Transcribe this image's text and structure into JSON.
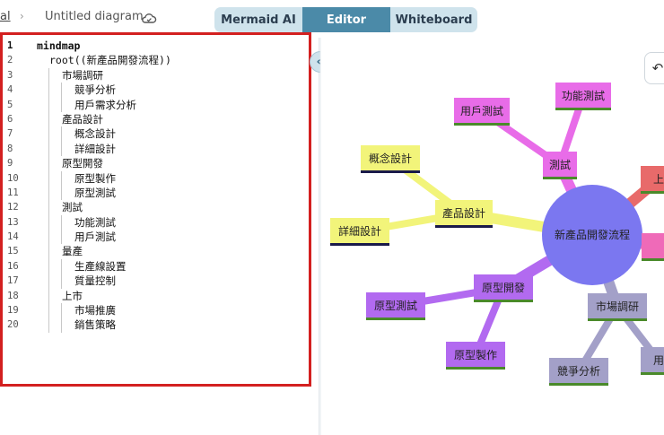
{
  "header": {
    "breadcrumb_prev": "al",
    "breadcrumb_sep": "›",
    "diagram_title": "Untitled diagram",
    "tabs": [
      "Mermaid AI",
      "Editor",
      "Whiteboard"
    ],
    "active_tab": "Editor"
  },
  "editor": {
    "lines": [
      {
        "n": "1",
        "text": "mindmap",
        "indent": 0
      },
      {
        "n": "2",
        "text": "root((新產品開發流程))",
        "indent": 1
      },
      {
        "n": "3",
        "text": "市場調研",
        "indent": 2
      },
      {
        "n": "4",
        "text": "競爭分析",
        "indent": 3
      },
      {
        "n": "5",
        "text": "用戶需求分析",
        "indent": 3
      },
      {
        "n": "6",
        "text": "產品設計",
        "indent": 2
      },
      {
        "n": "7",
        "text": "概念設計",
        "indent": 3
      },
      {
        "n": "8",
        "text": "詳細設計",
        "indent": 3
      },
      {
        "n": "9",
        "text": "原型開發",
        "indent": 2
      },
      {
        "n": "10",
        "text": "原型製作",
        "indent": 3
      },
      {
        "n": "11",
        "text": "原型測試",
        "indent": 3
      },
      {
        "n": "12",
        "text": "測試",
        "indent": 2
      },
      {
        "n": "13",
        "text": "功能測試",
        "indent": 3
      },
      {
        "n": "14",
        "text": "用戶測試",
        "indent": 3
      },
      {
        "n": "15",
        "text": "量產",
        "indent": 2
      },
      {
        "n": "16",
        "text": "生產線設置",
        "indent": 3
      },
      {
        "n": "17",
        "text": "質量控制",
        "indent": 3
      },
      {
        "n": "18",
        "text": "上市",
        "indent": 2
      },
      {
        "n": "19",
        "text": "市場推廣",
        "indent": 3
      },
      {
        "n": "20",
        "text": "銷售策略",
        "indent": 3
      }
    ]
  },
  "controls": {
    "collapse_icon": "«",
    "undo_icon": "↶"
  },
  "mindmap": {
    "root": "新產品開發流程",
    "root_color": "#7b77f0",
    "nodes": [
      {
        "id": "design",
        "label": "產品設計",
        "color": "#f2f47a",
        "underline": "#1a1a4a"
      },
      {
        "id": "concept",
        "label": "概念設計",
        "color": "#f2f47a",
        "underline": "#1a1a4a"
      },
      {
        "id": "detail",
        "label": "詳細設計",
        "color": "#f2f47a",
        "underline": "#1a1a4a"
      },
      {
        "id": "test",
        "label": "測試",
        "color": "#e86ce8",
        "underline": "#4a8a2a"
      },
      {
        "id": "functest",
        "label": "功能測試",
        "color": "#e86ce8",
        "underline": "#4a8a2a"
      },
      {
        "id": "usertest",
        "label": "用戶測試",
        "color": "#e86ce8",
        "underline": "#4a8a2a"
      },
      {
        "id": "proto",
        "label": "原型開發",
        "color": "#b26af0",
        "underline": "#4a8a2a"
      },
      {
        "id": "protomake",
        "label": "原型製作",
        "color": "#b26af0",
        "underline": "#4a8a2a"
      },
      {
        "id": "prototest",
        "label": "原型測試",
        "color": "#b26af0",
        "underline": "#4a8a2a"
      },
      {
        "id": "research",
        "label": "市場調研",
        "color": "#a3a0c8",
        "underline": "#4a8a2a"
      },
      {
        "id": "compete",
        "label": "競爭分析",
        "color": "#a3a0c8",
        "underline": "#4a8a2a"
      },
      {
        "id": "userneed",
        "label": "用",
        "color": "#a3a0c8",
        "underline": "#4a8a2a"
      },
      {
        "id": "launch",
        "label": "上",
        "color": "#e86a6a",
        "underline": "#4a8a2a"
      },
      {
        "id": "massprod",
        "label": "",
        "color": "#ef6ab8",
        "underline": "#4a8a2a"
      }
    ]
  }
}
